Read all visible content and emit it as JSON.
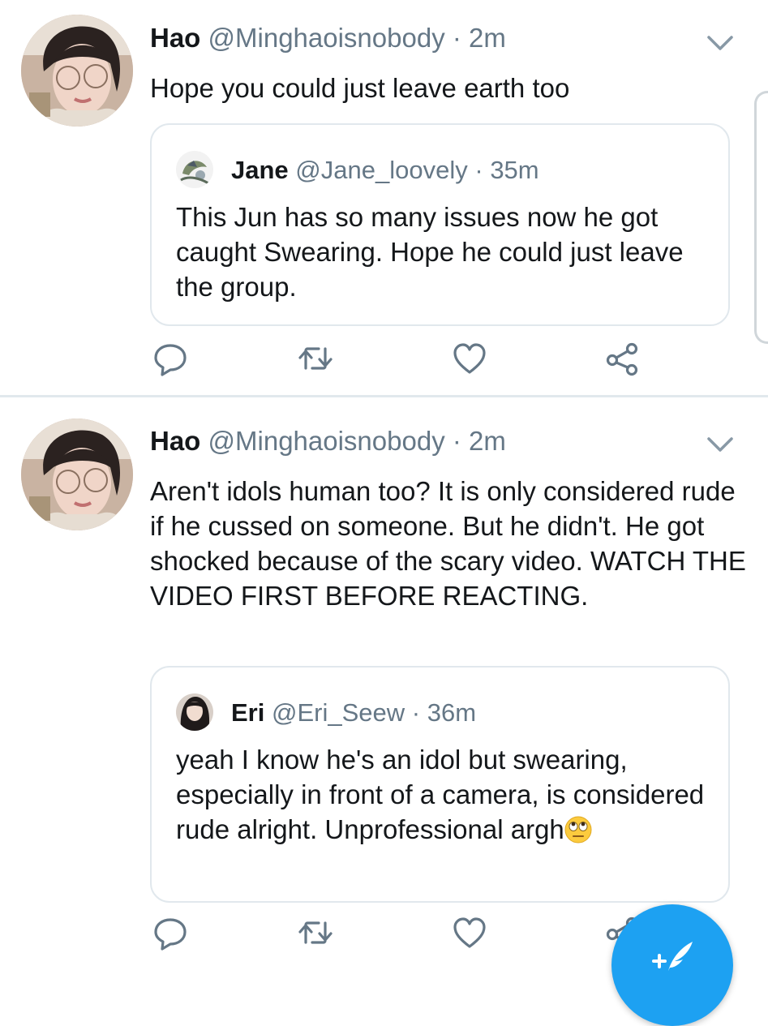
{
  "tweets": [
    {
      "author_name": "Hao",
      "handle": "@Minghaoisnobody",
      "separator": "·",
      "time": "2m",
      "text": "Hope you could just leave earth too",
      "quote": {
        "author_name": "Jane",
        "handle": "@Jane_loovely",
        "separator": "·",
        "time": "35m",
        "text": "This Jun has so many issues now he got caught Swearing. Hope he could just leave the group."
      }
    },
    {
      "author_name": "Hao",
      "handle": "@Minghaoisnobody",
      "separator": "·",
      "time": "2m",
      "text": "Aren't idols human too? It is only considered rude if he cussed on someone. But he didn't. He got shocked because of the scary video. WATCH THE VIDEO FIRST BEFORE REACTING.",
      "quote": {
        "author_name": "Eri",
        "handle": "@Eri_Seew",
        "separator": "·",
        "time": "36m",
        "text": "yeah I know he's an idol but swearing, especially in front of a camera, is considered rude alright. Unprofessional argh",
        "emoji": "face-with-rolling-eyes"
      }
    }
  ],
  "icons": {
    "reply": "reply-icon",
    "retweet": "retweet-icon",
    "like": "like-icon",
    "share": "share-icon",
    "more": "chevron-down-icon",
    "compose": "compose-tweet-icon"
  },
  "colors": {
    "accent": "#1da1f2",
    "icon_gray": "#657786",
    "text": "#14171a",
    "border": "#e1e8ed"
  }
}
